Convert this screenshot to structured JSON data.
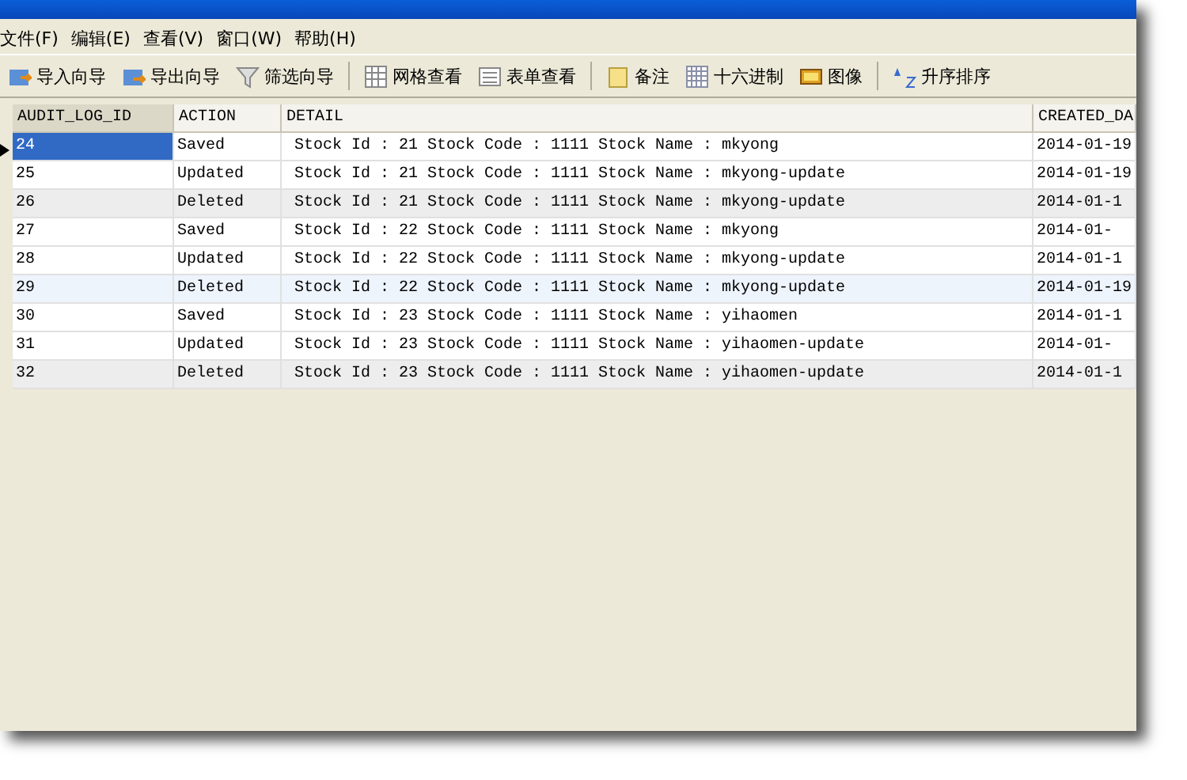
{
  "menu": [
    "文件(F)",
    "编辑(E)",
    "查看(V)",
    "窗口(W)",
    "帮助(H)"
  ],
  "toolbar": [
    [
      "导入向导",
      "导出向导",
      "筛选向导"
    ],
    [
      "网格查看",
      "表单查看"
    ],
    [
      "备注",
      "十六进制",
      "图像"
    ],
    [
      "升序排序"
    ]
  ],
  "table": {
    "columns": [
      "AUDIT_LOG_ID",
      "ACTION",
      "DETAIL",
      "CREATED_DA"
    ],
    "rows": [
      {
        "cells": [
          "24",
          "Saved",
          "Stock Id : 21 Stock Code : 1111 Stock Name : mkyong",
          "2014-01-19"
        ],
        "selected": true,
        "highlighted": false
      },
      {
        "cells": [
          "25",
          "Updated",
          "Stock Id : 21 Stock Code : 1111 Stock Name : mkyong-update",
          "2014-01-19"
        ],
        "selected": false,
        "highlighted": false
      },
      {
        "cells": [
          "26",
          "Deleted",
          "Stock Id : 21 Stock Code : 1111 Stock Name : mkyong-update",
          "2014-01-1"
        ],
        "selected": false,
        "highlighted": false
      },
      {
        "cells": [
          "27",
          "Saved",
          "Stock Id : 22 Stock Code : 1111 Stock Name : mkyong",
          "2014-01-"
        ],
        "selected": false,
        "highlighted": false
      },
      {
        "cells": [
          "28",
          "Updated",
          "Stock Id : 22 Stock Code : 1111 Stock Name : mkyong-update",
          "2014-01-1"
        ],
        "selected": false,
        "highlighted": false
      },
      {
        "cells": [
          "29",
          "Deleted",
          "Stock Id : 22 Stock Code : 1111 Stock Name : mkyong-update",
          "2014-01-19"
        ],
        "selected": false,
        "highlighted": true
      },
      {
        "cells": [
          "30",
          "Saved",
          "Stock Id : 23 Stock Code : 1111 Stock Name : yihaomen",
          "2014-01-1"
        ],
        "selected": false,
        "highlighted": false
      },
      {
        "cells": [
          "31",
          "Updated",
          "Stock Id : 23 Stock Code : 1111 Stock Name : yihaomen-update",
          "2014-01-"
        ],
        "selected": false,
        "highlighted": false
      },
      {
        "cells": [
          "32",
          "Deleted",
          "Stock Id : 23 Stock Code : 1111 Stock Name : yihaomen-update",
          "2014-01-1"
        ],
        "selected": false,
        "highlighted": false
      }
    ]
  }
}
